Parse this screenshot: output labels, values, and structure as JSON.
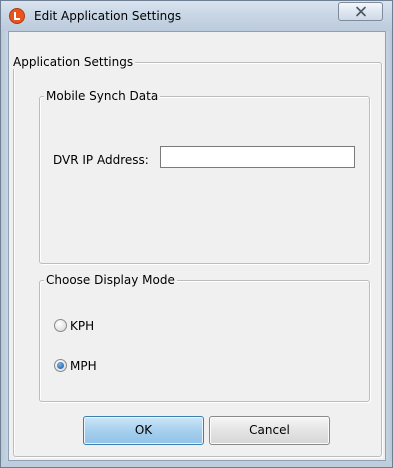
{
  "window": {
    "title": "Edit Application Settings",
    "icon": "app-logo-icon",
    "close_icon": "close-icon"
  },
  "application_settings": {
    "label": "Application Settings"
  },
  "mobile_synch": {
    "label": "Mobile Synch Data",
    "dvr_ip_label": "DVR IP Address:",
    "dvr_ip_value": "",
    "dvr_ip_placeholder": ""
  },
  "display_mode": {
    "label": "Choose Display Mode",
    "options": [
      {
        "label": "KPH",
        "selected": false
      },
      {
        "label": "MPH",
        "selected": true
      }
    ]
  },
  "buttons": {
    "ok_label": "OK",
    "cancel_label": "Cancel"
  },
  "colors": {
    "title_bar": "#c7d5e4",
    "client_bg": "#f0f0f0",
    "ok_button": "#a6d0ee",
    "radio_selected": "#2c6fb8",
    "app_icon": "#e8541e"
  }
}
